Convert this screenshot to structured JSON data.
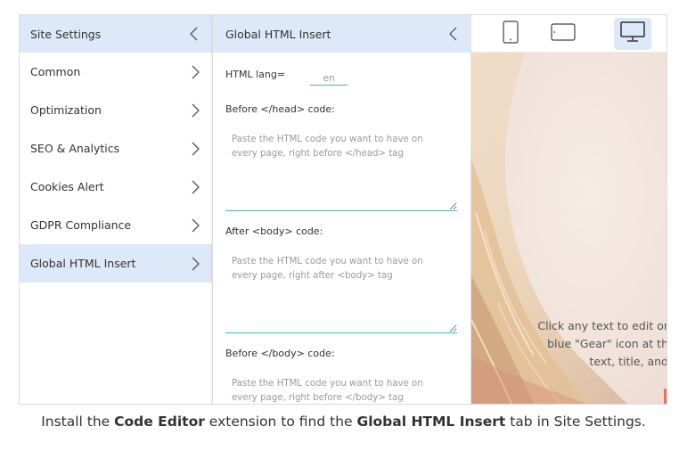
{
  "sidebar": {
    "title": "Site Settings",
    "items": [
      {
        "label": "Common"
      },
      {
        "label": "Optimization"
      },
      {
        "label": "SEO & Analytics"
      },
      {
        "label": "Cookies Alert"
      },
      {
        "label": "GDPR Compliance"
      },
      {
        "label": "Global HTML Insert",
        "active": true
      }
    ]
  },
  "panel": {
    "title": "Global HTML Insert",
    "lang_label": "HTML lang=",
    "lang_value": "en",
    "fields": [
      {
        "label": "Before </head> code:",
        "placeholder": "Paste the HTML code you want to have on every page, right before </head> tag"
      },
      {
        "label": "After <body> code:",
        "placeholder": "Paste the HTML code you want to have on every page, right after <body> tag"
      },
      {
        "label": "Before </body> code:",
        "placeholder": "Paste the HTML code you want to have on every page, right before </body> tag"
      }
    ]
  },
  "toolbar": {
    "devices": [
      "tablet-portrait-icon",
      "tablet-landscape-icon",
      "desktop-icon"
    ],
    "active_device": "desktop-icon"
  },
  "preview": {
    "lines": [
      "Click any text to edit or",
      "blue \"Gear\" icon at th",
      "text, title, and"
    ]
  },
  "caption": {
    "part1": "Install the ",
    "bold1": "Code Editor",
    "part2": " extension to find the ",
    "bold2": "Global HTML Insert",
    "part3": " tab in Site Settings."
  },
  "colors": {
    "accent_bg": "#dde8f8",
    "input_underline": "#4db6ac",
    "preview_accent": "#ee6e5a"
  }
}
